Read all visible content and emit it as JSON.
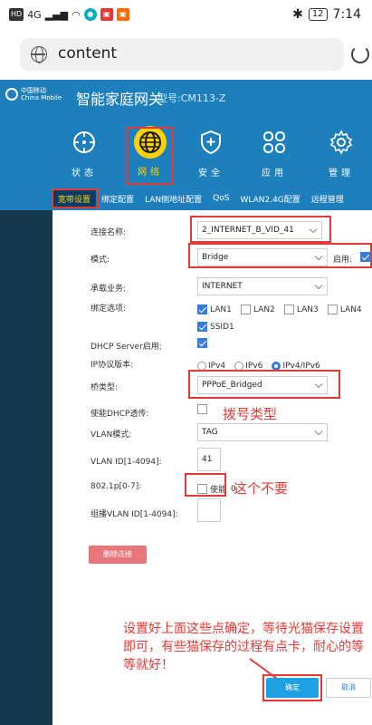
{
  "status_bar": {
    "left_chips": [
      "HD",
      "4G"
    ],
    "right_icons": [
      "bluetooth-icon",
      "battery-icon"
    ],
    "battery": "12",
    "time": "7:14"
  },
  "address_bar": {
    "url": "content"
  },
  "header": {
    "brand_line1": "中国移动",
    "brand_line2": "China Mobile",
    "title": "智能家庭网关",
    "model": "型号:CM113-Z"
  },
  "top_nav": [
    {
      "label": "状态",
      "icon": "status-icon"
    },
    {
      "label": "网络",
      "icon": "globe-icon"
    },
    {
      "label": "安全",
      "icon": "shield-plus-icon"
    },
    {
      "label": "应用",
      "icon": "apps-icon"
    },
    {
      "label": "管理",
      "icon": "gear-icon"
    }
  ],
  "sub_tabs": [
    "宽带设置",
    "绑定配置",
    "LAN侧地址配置",
    "QoS",
    "WLAN2.4G配置",
    "远程管理"
  ],
  "form": {
    "connection_name_label": "连接名称:",
    "connection_name_value": "2_INTERNET_B_VID_41",
    "mode_label": "模式:",
    "mode_value": "Bridge",
    "enable_label": "启用:",
    "service_label": "承载业务:",
    "service_value": "INTERNET",
    "bind_label": "绑定选项:",
    "bind_options": [
      "LAN1",
      "LAN2",
      "LAN3",
      "LAN4",
      "SSID1"
    ],
    "dhcp_label": "DHCP Server启用:",
    "ip_label": "IP协议版本:",
    "ip_options": [
      "IPv4",
      "IPv6",
      "IPv4/IPv6"
    ],
    "bridge_type_label": "桥类型:",
    "bridge_type_value": "PPPoE_Bridged",
    "dhcp_pass_label": "使能DHCP透传:",
    "vlan_mode_label": "VLAN模式:",
    "vlan_mode_value": "TAG",
    "vlan_id_label": "VLAN ID[1-4094]:",
    "vlan_id_value": "41",
    "p8021_label": "802.1p[0-7]:",
    "p8021_enable": "使能",
    "p8021_value": "0",
    "mcast_label": "组播VLAN ID[1-4094]:",
    "delete_button": "删除连接",
    "ok_button": "确定",
    "cancel_button": "取消"
  },
  "annotations": {
    "dial_type": "拨号类型",
    "not_needed": "这个不要",
    "instruction": "设置好上面这些点确定，等待光猫保存设置即可，有些猫保存的过程有点卡，耐心的等等就好！"
  },
  "colors": {
    "brand_blue": "#1d7fbc",
    "highlight_yellow": "#ffd100",
    "annotation_red": "#e53935"
  }
}
